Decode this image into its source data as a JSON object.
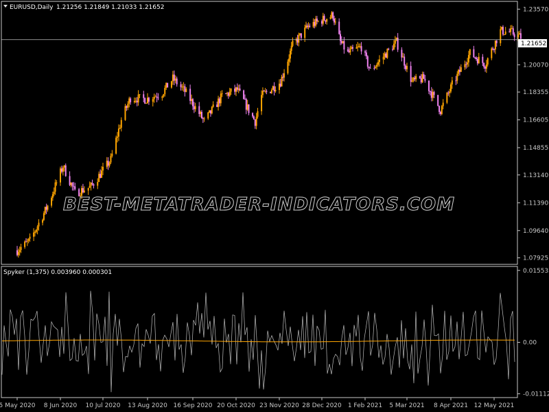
{
  "main_panel": {
    "caption_symbol": "EURUSD,Daily",
    "caption_ohlc": "1.21256 1.21849 1.21033 1.21652",
    "current_price_label": "1.21652",
    "watermark": "BEST-METATRADER-INDICATORS.COM"
  },
  "indicator_panel": {
    "caption": "Spyker (1,375) 0.003960 0.000301"
  },
  "colors": {
    "background": "#000000",
    "frame": "#c8c8c8",
    "bull_candle": "#ffa500",
    "bear_candle": "#ee82ee",
    "price_line": "#c0c0c0",
    "osc_line": "#c0c0c0",
    "signal_line": "#ffa500"
  },
  "chart_data": [
    {
      "type": "candlestick",
      "title": "EURUSD,Daily",
      "y_ticks": [
        "1.23570",
        "1.21652",
        "1.20070",
        "1.18355",
        "1.16605",
        "1.14855",
        "1.13140",
        "1.11390",
        "1.09640",
        "1.07925"
      ],
      "ylim": [
        1.076,
        1.238
      ],
      "x_ticks": [
        "5 May 2020",
        "8 Jun 2020",
        "10 Jul 2020",
        "13 Aug 2020",
        "16 Sep 2020",
        "20 Oct 2020",
        "23 Nov 2020",
        "28 Dec 2020",
        "1 Feb 2021",
        "5 Mar 2021",
        "8 Apr 2021",
        "12 May 2021"
      ],
      "last_close": 1.21652,
      "path_anchors": [
        [
          "5 May 2020",
          1.084
        ],
        [
          "15 May 2020",
          1.09
        ],
        [
          "29 May 2020",
          1.112
        ],
        [
          "10 Jun 2020",
          1.137
        ],
        [
          "19 Jun 2020",
          1.12
        ],
        [
          "1 Jul 2020",
          1.124
        ],
        [
          "16 Jul 2020",
          1.141
        ],
        [
          "24 Jul 2020",
          1.166
        ],
        [
          "31 Jul 2020",
          1.18
        ],
        [
          "12 Aug 2020",
          1.179
        ],
        [
          "24 Aug 2020",
          1.183
        ],
        [
          "1 Sep 2020",
          1.192
        ],
        [
          "10 Sep 2020",
          1.184
        ],
        [
          "25 Sep 2020",
          1.165
        ],
        [
          "9 Oct 2020",
          1.181
        ],
        [
          "21 Oct 2020",
          1.185
        ],
        [
          "4 Nov 2020",
          1.165
        ],
        [
          "9 Nov 2020",
          1.181
        ],
        [
          "24 Nov 2020",
          1.19
        ],
        [
          "4 Dec 2020",
          1.213
        ],
        [
          "17 Dec 2020",
          1.225
        ],
        [
          "6 Jan 2021",
          1.232
        ],
        [
          "12 Jan 2021",
          1.215
        ],
        [
          "18 Jan 2021",
          1.208
        ],
        [
          "29 Jan 2021",
          1.212
        ],
        [
          "5 Feb 2021",
          1.197
        ],
        [
          "25 Feb 2021",
          1.215
        ],
        [
          "9 Mar 2021",
          1.19
        ],
        [
          "18 Mar 2021",
          1.192
        ],
        [
          "31 Mar 2021",
          1.172
        ],
        [
          "9 Apr 2021",
          1.188
        ],
        [
          "23 Apr 2021",
          1.208
        ],
        [
          "5 May 2021",
          1.201
        ],
        [
          "17 May 2021",
          1.222
        ],
        [
          "26 May 2021",
          1.221
        ],
        [
          "2 Jun 2021",
          1.218
        ]
      ]
    },
    {
      "type": "line",
      "title": "Spyker (1,375)",
      "y_ticks": [
        "0.015532",
        "0.00",
        "-0.011121"
      ],
      "ylim": [
        -0.0115,
        0.0158
      ],
      "series": [
        {
          "values_last": 0.00396
        },
        {
          "values_last": 0.000301
        }
      ]
    }
  ]
}
